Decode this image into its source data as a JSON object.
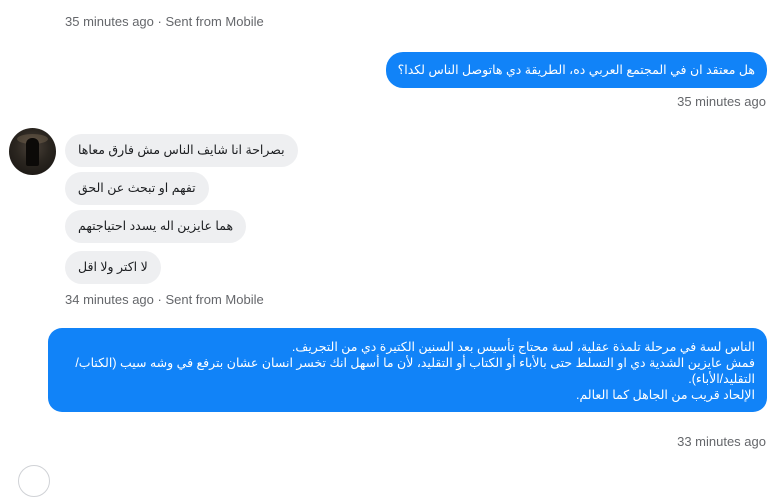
{
  "messages": [
    {
      "meta": "35 minutes ago · Sent from Mobile"
    },
    {
      "outgoing_1": "هل معتقد ان في المجتمع العربي ده، الطريقة دي هاتوصل الناس لكدا؟",
      "meta": "35 minutes ago"
    },
    {
      "incoming": [
        "بصراحة انا شايف الناس مش فارق معاها",
        "تفهم او تبحث عن الحق",
        "هما عايزين اله يسدد احتياجتهم",
        "لا اكتر ولا اقل"
      ],
      "meta": "34 minutes ago · Sent from Mobile"
    },
    {
      "outgoing_2": [
        "الناس لسة في مرحلة تلمذة عقلية، لسة محتاج تأسيس بعد السنين الكتيرة دي من التجريف.",
        "فمش عايزين الشدية دي او التسلط حتى بالأباء أو الكتاب أو التقليد، لأن ما أسهل انك تخسر انسان عشان بترفع في وشه سيب (الكتاب/",
        "التقليد/الأباء).",
        "الإلحاد قريب من الجاهل كما العالم."
      ],
      "meta": "33 minutes ago"
    }
  ],
  "avatar_icon": "user-avatar-photo",
  "colors": {
    "outgoing_bubble": "#1183f8",
    "incoming_bubble": "#eeeff1",
    "meta_text": "#65676b"
  }
}
